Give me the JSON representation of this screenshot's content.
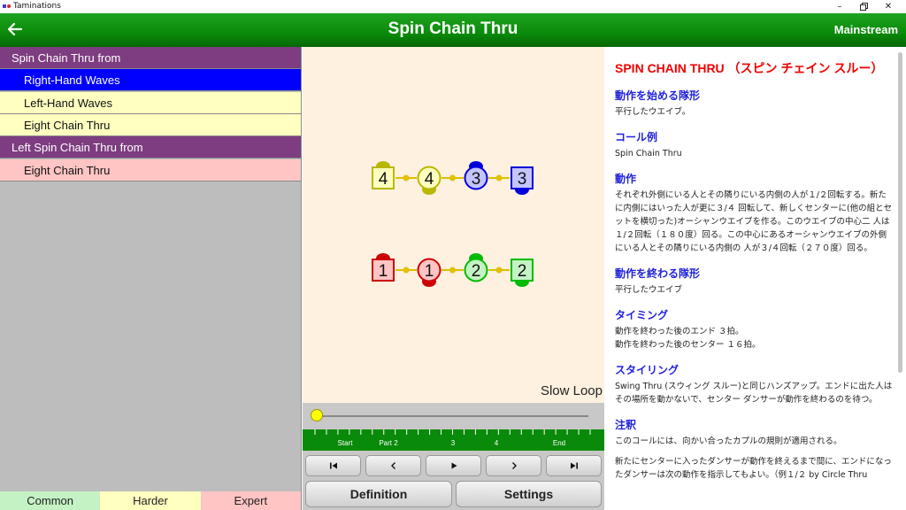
{
  "window": {
    "title": "Taminations"
  },
  "header": {
    "title": "Spin Chain Thru",
    "level": "Mainstream"
  },
  "list": {
    "rows": [
      {
        "type": "group",
        "label": "Spin Chain Thru from"
      },
      {
        "type": "item",
        "label": "Right-Hand Waves",
        "style": "sel"
      },
      {
        "type": "item",
        "label": "Left-Hand Waves",
        "style": "yellow"
      },
      {
        "type": "item",
        "label": "Eight Chain Thru",
        "style": "yellow"
      },
      {
        "type": "group",
        "label": "Left Spin Chain Thru from"
      },
      {
        "type": "item",
        "label": "Eight Chain Thru",
        "style": "pink"
      }
    ]
  },
  "levels": [
    {
      "label": "Common",
      "color": "#c4f2c4"
    },
    {
      "label": "Harder",
      "color": "#ffffc0"
    },
    {
      "label": "Expert",
      "color": "#ffc4c4"
    }
  ],
  "dancers": [
    {
      "number": "4",
      "shape": "square",
      "color": "#b8b800",
      "fill": "#ffffc0",
      "couple": 4
    },
    {
      "number": "4",
      "shape": "circle",
      "color": "#b8b800",
      "fill": "#ffffc0",
      "couple": 4
    },
    {
      "number": "3",
      "shape": "circle",
      "color": "#0000dd",
      "fill": "#c4c4ff",
      "couple": 3
    },
    {
      "number": "3",
      "shape": "square",
      "color": "#0000dd",
      "fill": "#c4c4ff",
      "couple": 3
    },
    {
      "number": "1",
      "shape": "square",
      "color": "#cc0000",
      "fill": "#ffc4c4",
      "couple": 1
    },
    {
      "number": "1",
      "shape": "circle",
      "color": "#cc0000",
      "fill": "#ffc4c4",
      "couple": 1
    },
    {
      "number": "2",
      "shape": "circle",
      "color": "#00bb00",
      "fill": "#c4f2c4",
      "couple": 2
    },
    {
      "number": "2",
      "shape": "square",
      "color": "#00bb00",
      "fill": "#c4f2c4",
      "couple": 2
    }
  ],
  "animation": {
    "loop_label": "Slow Loop",
    "progress": 0,
    "parts": [
      "Start",
      "Part 2",
      "3",
      "4",
      "End"
    ]
  },
  "controls": {
    "start_icon": "skip-to-start-icon",
    "back_icon": "step-back-icon",
    "play_icon": "play-icon",
    "forward_icon": "step-forward-icon",
    "end_icon": "skip-to-end-icon",
    "definition_label": "Definition",
    "settings_label": "Settings"
  },
  "definition": {
    "title": "SPIN CHAIN THRU （スピン チェイン スルー）",
    "sections": [
      {
        "heading": "動作を始める隊形",
        "paragraphs": [
          "平行したウエイブ。"
        ]
      },
      {
        "heading": "コール例",
        "paragraphs": [
          "Spin Chain Thru"
        ]
      },
      {
        "heading": "動作",
        "paragraphs": [
          "それぞれ外側にいる人とその隣りにいる内側の人が１/２回転する。新たに内側にはいった人が更に３/４ 回転して、新しくセンターに(他の組とセットを横切った)オーシャンウエイブを作る。このウエイブの中心二 人は１/２回転（１８０度）回る。この中心にあるオーシャンウエイブの外側にいる人とその隣りにいる内側の 人が３/４回転（２７０度）回る。"
        ]
      },
      {
        "heading": "動作を終わる隊形",
        "paragraphs": [
          "平行したウエイブ"
        ]
      },
      {
        "heading": "タイミング",
        "paragraphs": [
          "動作を終わった後のエンド ３拍。\n動作を終わった後のセンター １６拍。"
        ]
      },
      {
        "heading": "スタイリング",
        "paragraphs": [
          "Swing Thru (スウィング スルー)と同じハンズアップ。エンドに出た人はその場所を動かないで、センター ダンサーが動作を終わるのを待つ。"
        ]
      },
      {
        "heading": "注釈",
        "paragraphs": [
          "このコールには、向かい合ったカプルの規則が適用される。",
          "新たにセンターに入ったダンサーが動作を終えるまで間に、エンドになったダンサーは次の動作を指示してもよい。（例１/２ by Circle Thru"
        ]
      }
    ]
  }
}
